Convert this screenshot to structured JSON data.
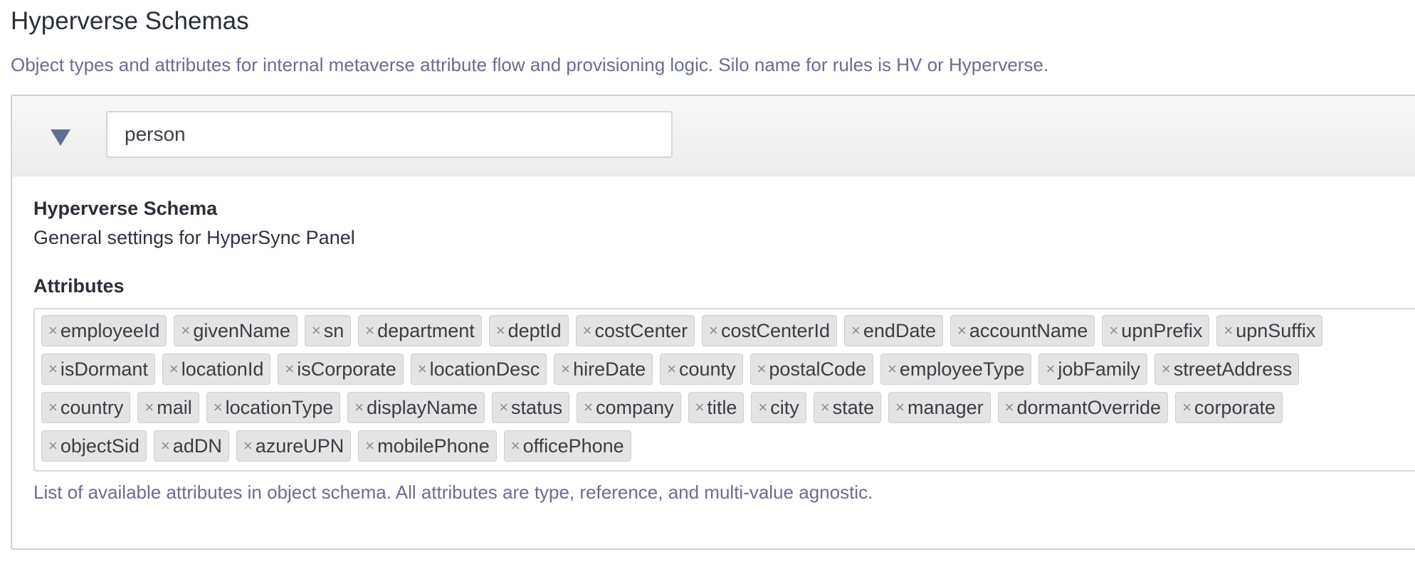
{
  "page": {
    "title": "Hyperverse Schemas",
    "description": "Object types and attributes for internal metaverse attribute flow and provisioning logic. Silo name for rules is HV or Hyperverse."
  },
  "header": {
    "toggle_icon": "caret-down-icon",
    "object_type_value": "person"
  },
  "schema": {
    "title": "Hyperverse Schema",
    "subtitle": "General settings for HyperSync Panel"
  },
  "attributes": {
    "label": "Attributes",
    "help": "List of available attributes in object schema. All attributes are type, reference, and multi-value agnostic.",
    "remove_glyph": "×",
    "rows": [
      [
        "employeeId",
        "givenName",
        "sn",
        "department",
        "deptId",
        "costCenter",
        "costCenterId",
        "endDate",
        "accountName",
        "upnPrefix",
        "upnSuffix"
      ],
      [
        "isDormant",
        "locationId",
        "isCorporate",
        "locationDesc",
        "hireDate",
        "county",
        "postalCode",
        "employeeType",
        "jobFamily",
        "streetAddress"
      ],
      [
        "country",
        "mail",
        "locationType",
        "displayName",
        "status",
        "company",
        "title",
        "city",
        "state",
        "manager",
        "dormantOverride",
        "corporate"
      ],
      [
        "objectSid",
        "adDN",
        "azureUPN",
        "mobilePhone",
        "officePhone"
      ]
    ]
  },
  "colors": {
    "accent": "#5f6f8f",
    "muted_text": "#6a6d8d",
    "tag_bg": "#e4e4e4"
  }
}
